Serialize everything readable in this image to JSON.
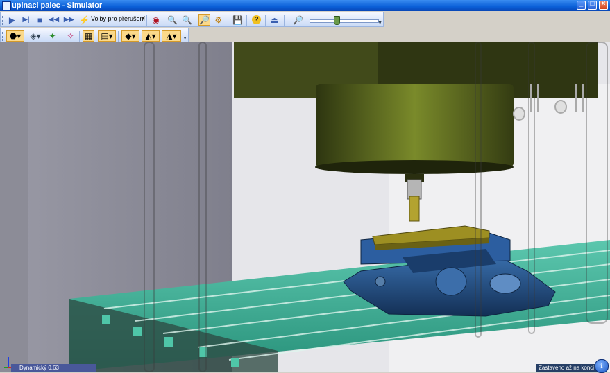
{
  "window": {
    "title": "upinaci palec - Simulator",
    "controls": {
      "minimize": "_",
      "maximize": "□",
      "close": "×"
    }
  },
  "toolbar1": {
    "buttons": [
      {
        "name": "play-button",
        "icon": "▶"
      },
      {
        "name": "step-button",
        "icon": "⏭"
      },
      {
        "name": "stop-button",
        "icon": "■"
      },
      {
        "name": "rewind-button",
        "icon": "◀◀"
      },
      {
        "name": "fast-forward-button",
        "icon": "▶▶"
      }
    ],
    "interrupt_options_label": "Volby pro přerušení",
    "zoom_slider_value": 0.38
  },
  "status": {
    "left": "Dynamický 0.63",
    "right": "Zastaveno až na konci"
  },
  "colors": {
    "titlebar": "#0a5fd8",
    "toolbar": "#dbe7fb",
    "active_button": "#fbd98a",
    "machine_head": "#3f4a18",
    "table": "#3aa78f",
    "vise": "#1e4e86",
    "workpiece": "#9d8f22",
    "background_wall": "#8e8e9a"
  }
}
